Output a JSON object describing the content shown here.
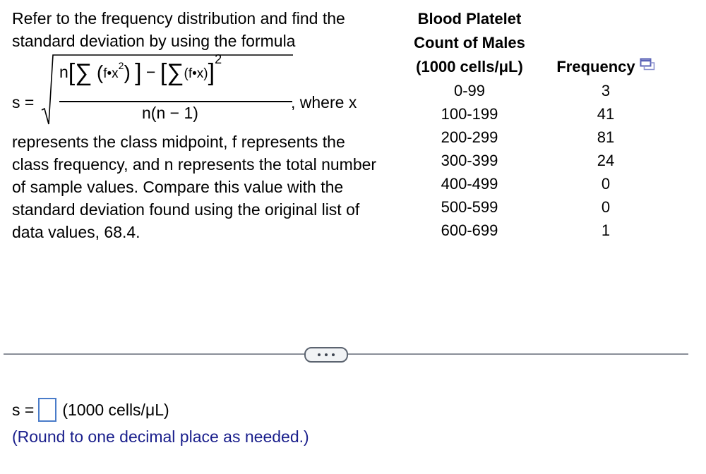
{
  "question": {
    "intro": "Refer to the frequency distribution and find the standard deviation by using the formula",
    "formula": {
      "lhs": "s =",
      "numerator_n": "n",
      "sum_symbol": "∑",
      "term1_open": "(",
      "term1_body": "f•x",
      "term1_exp": "2",
      "term1_close": ")",
      "minus": "−",
      "term2_body": "(f•x)",
      "term2_exp": "2",
      "denominator": "n(n − 1)",
      "suffix": ", where x"
    },
    "body": "represents the class midpoint, f represents the class frequency, and n represents the total number of sample values. Compare this value with the standard deviation found using the original list of data values, 68.4."
  },
  "table": {
    "headers": {
      "class": "Blood Platelet Count of Males (1000 cells/μL)",
      "class_line1": "Blood Platelet",
      "class_line2": "Count of Males",
      "class_line3": "(1000 cells/μL)",
      "frequency": "Frequency"
    },
    "copy_icon": "copy-icon",
    "rows": [
      {
        "class": "0-99",
        "frequency": "3"
      },
      {
        "class": "100-199",
        "frequency": "41"
      },
      {
        "class": "200-299",
        "frequency": "81"
      },
      {
        "class": "300-399",
        "frequency": "24"
      },
      {
        "class": "400-499",
        "frequency": "0"
      },
      {
        "class": "500-599",
        "frequency": "0"
      },
      {
        "class": "600-699",
        "frequency": "1"
      }
    ]
  },
  "divider": {
    "more_button": "more-options"
  },
  "answer": {
    "lhs": "s =",
    "value": "",
    "unit": "(1000 cells/μL)",
    "hint": "(Round to one decimal place as needed.)"
  },
  "colors": {
    "hint_text": "#1a1f8c",
    "input_border": "#4a7cc9",
    "divider": "#8a8f99",
    "copy_icon": "#5b63b7"
  }
}
